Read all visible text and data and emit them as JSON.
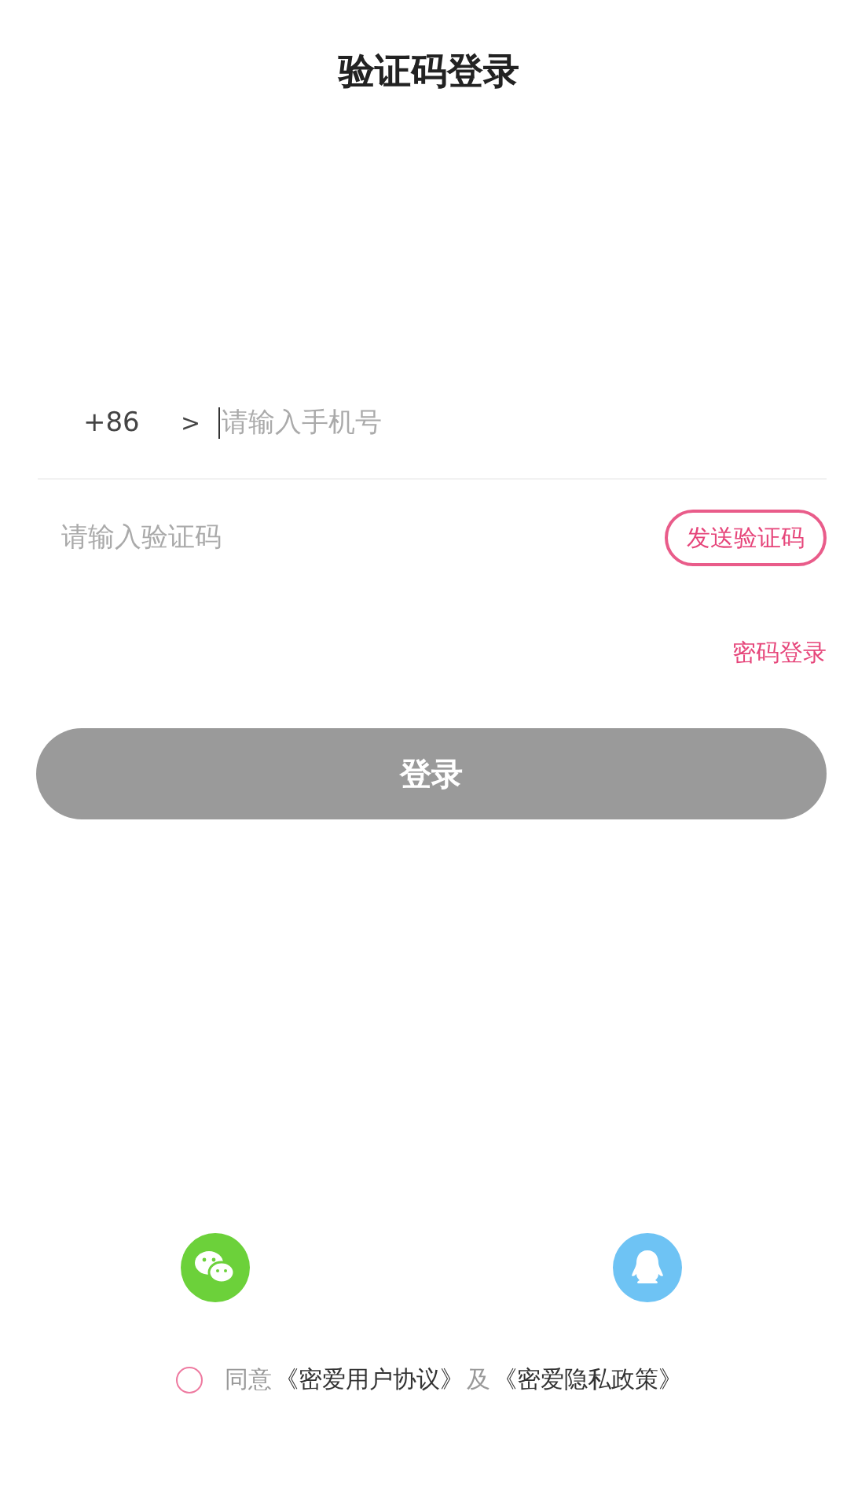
{
  "title": "验证码登录",
  "phone": {
    "country_code": "+86",
    "chevron": ">",
    "placeholder": "请输入手机号"
  },
  "code": {
    "placeholder": "请输入验证码",
    "send_button": "发送验证码"
  },
  "password_login_link": "密码登录",
  "login_button": {
    "label": "登录",
    "disabled": true
  },
  "social_logins": [
    {
      "kind": "wechat"
    },
    {
      "kind": "qq"
    }
  ],
  "agreement": {
    "checked": false,
    "prefix": "同意",
    "link_1": "《密爱用户协议》",
    "joiner": "及",
    "link_2": "《密爱隐私政策》"
  }
}
